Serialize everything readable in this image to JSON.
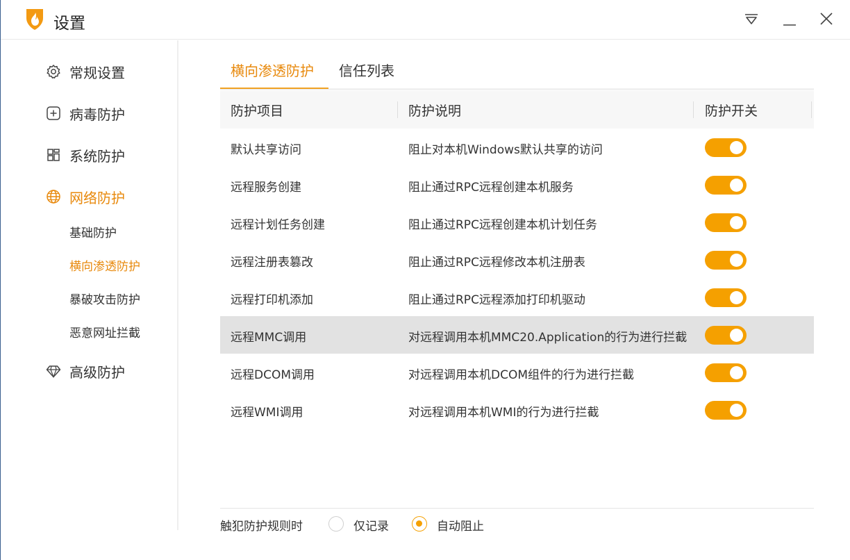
{
  "window": {
    "title": "设置"
  },
  "sidebar": {
    "items": [
      {
        "label": "常规设置",
        "icon": "gear-icon"
      },
      {
        "label": "病毒防护",
        "icon": "plus-square-icon"
      },
      {
        "label": "系统防护",
        "icon": "grid-icon"
      },
      {
        "label": "网络防护",
        "icon": "globe-icon"
      },
      {
        "label": "高级防护",
        "icon": "diamond-icon"
      }
    ],
    "sub_items": [
      {
        "label": "基础防护"
      },
      {
        "label": "横向渗透防护"
      },
      {
        "label": "暴破攻击防护"
      },
      {
        "label": "恶意网址拦截"
      }
    ]
  },
  "tabs": [
    {
      "label": "横向渗透防护"
    },
    {
      "label": "信任列表"
    }
  ],
  "table": {
    "headers": [
      "防护项目",
      "防护说明",
      "防护开关"
    ],
    "rows": [
      {
        "item": "默认共享访问",
        "desc": "阻止对本机Windows默认共享的访问",
        "enabled": true
      },
      {
        "item": "远程服务创建",
        "desc": "阻止通过RPC远程创建本机服务",
        "enabled": true
      },
      {
        "item": "远程计划任务创建",
        "desc": "阻止通过RPC远程创建本机计划任务",
        "enabled": true
      },
      {
        "item": "远程注册表篡改",
        "desc": "阻止通过RPC远程修改本机注册表",
        "enabled": true
      },
      {
        "item": "远程打印机添加",
        "desc": "阻止通过RPC远程添加打印机驱动",
        "enabled": true
      },
      {
        "item": "远程MMC调用",
        "desc": "对远程调用本机MMC20.Application的行为进行拦截",
        "enabled": true
      },
      {
        "item": "远程DCOM调用",
        "desc": "对远程调用本机DCOM组件的行为进行拦截",
        "enabled": true
      },
      {
        "item": "远程WMI调用",
        "desc": "对远程调用本机WMI的行为进行拦截",
        "enabled": true
      }
    ]
  },
  "footer": {
    "label": "触犯防护规则时",
    "options": [
      {
        "label": "仅记录",
        "checked": false
      },
      {
        "label": "自动阻止",
        "checked": true
      }
    ]
  },
  "colors": {
    "accent": "#e8890c",
    "toggle_on": "#f5a000",
    "row_highlight": "#e2e2e2"
  }
}
